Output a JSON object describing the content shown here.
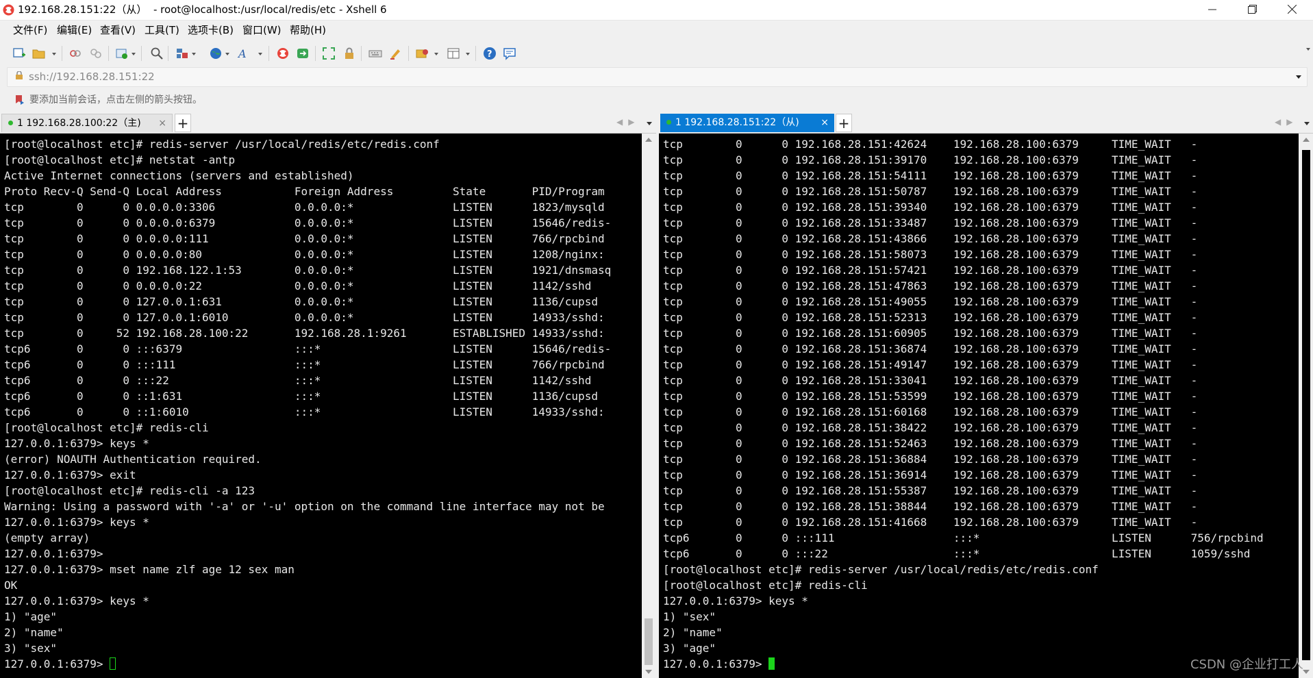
{
  "window": {
    "title": "192.168.28.151:22（从）  - root@localhost:/usr/local/redis/etc - Xshell 6",
    "minimize": "—",
    "close": "✕"
  },
  "menu": [
    "文件(F)",
    "编辑(E)",
    "查看(V)",
    "工具(T)",
    "选项卡(B)",
    "窗口(W)",
    "帮助(H)"
  ],
  "address": {
    "url": "ssh://192.168.28.151:22"
  },
  "hint": {
    "text": "要添加当前会话，点击左侧的箭头按钮。"
  },
  "tabs": {
    "left": {
      "label": "1 192.168.28.100:22（主)",
      "close": "×",
      "add": "+"
    },
    "right": {
      "label": "1 192.168.28.151:22（从)",
      "close": "×",
      "add": "+"
    }
  },
  "terminals": {
    "left": {
      "lines": [
        "[root@localhost etc]# redis-server /usr/local/redis/etc/redis.conf",
        "[root@localhost etc]# netstat -antp",
        "Active Internet connections (servers and established)",
        "Proto Recv-Q Send-Q Local Address           Foreign Address         State       PID/Program",
        "tcp        0      0 0.0.0.0:3306            0.0.0.0:*               LISTEN      1823/mysqld",
        "tcp        0      0 0.0.0.0:6379            0.0.0.0:*               LISTEN      15646/redis-",
        "tcp        0      0 0.0.0.0:111             0.0.0.0:*               LISTEN      766/rpcbind",
        "tcp        0      0 0.0.0.0:80              0.0.0.0:*               LISTEN      1208/nginx:",
        "tcp        0      0 192.168.122.1:53        0.0.0.0:*               LISTEN      1921/dnsmasq",
        "tcp        0      0 0.0.0.0:22              0.0.0.0:*               LISTEN      1142/sshd",
        "tcp        0      0 127.0.0.1:631           0.0.0.0:*               LISTEN      1136/cupsd",
        "tcp        0      0 127.0.0.1:6010          0.0.0.0:*               LISTEN      14933/sshd:",
        "tcp        0     52 192.168.28.100:22       192.168.28.1:9261       ESTABLISHED 14933/sshd:",
        "tcp6       0      0 :::6379                 :::*                    LISTEN      15646/redis-",
        "tcp6       0      0 :::111                  :::*                    LISTEN      766/rpcbind",
        "tcp6       0      0 :::22                   :::*                    LISTEN      1142/sshd",
        "tcp6       0      0 ::1:631                 :::*                    LISTEN      1136/cupsd",
        "tcp6       0      0 ::1:6010                :::*                    LISTEN      14933/sshd:",
        "[root@localhost etc]# redis-cli",
        "127.0.0.1:6379> keys *",
        "(error) NOAUTH Authentication required.",
        "127.0.0.1:6379> exit",
        "[root@localhost etc]# redis-cli -a 123",
        "Warning: Using a password with '-a' or '-u' option on the command line interface may not be",
        "127.0.0.1:6379> keys *",
        "(empty array)",
        "127.0.0.1:6379>",
        "127.0.0.1:6379> mset name zlf age 12 sex man",
        "OK",
        "127.0.0.1:6379> keys *",
        "1) \"age\"",
        "2) \"name\"",
        "3) \"sex\""
      ],
      "prompt": "127.0.0.1:6379> "
    },
    "right": {
      "lines": [
        "tcp        0      0 192.168.28.151:42624    192.168.28.100:6379     TIME_WAIT   -",
        "tcp        0      0 192.168.28.151:39170    192.168.28.100:6379     TIME_WAIT   -",
        "tcp        0      0 192.168.28.151:54111    192.168.28.100:6379     TIME_WAIT   -",
        "tcp        0      0 192.168.28.151:50787    192.168.28.100:6379     TIME_WAIT   -",
        "tcp        0      0 192.168.28.151:39340    192.168.28.100:6379     TIME_WAIT   -",
        "tcp        0      0 192.168.28.151:33487    192.168.28.100:6379     TIME_WAIT   -",
        "tcp        0      0 192.168.28.151:43866    192.168.28.100:6379     TIME_WAIT   -",
        "tcp        0      0 192.168.28.151:58073    192.168.28.100:6379     TIME_WAIT   -",
        "tcp        0      0 192.168.28.151:57421    192.168.28.100:6379     TIME_WAIT   -",
        "tcp        0      0 192.168.28.151:47863    192.168.28.100:6379     TIME_WAIT   -",
        "tcp        0      0 192.168.28.151:49055    192.168.28.100:6379     TIME_WAIT   -",
        "tcp        0      0 192.168.28.151:52313    192.168.28.100:6379     TIME_WAIT   -",
        "tcp        0      0 192.168.28.151:60905    192.168.28.100:6379     TIME_WAIT   -",
        "tcp        0      0 192.168.28.151:36874    192.168.28.100:6379     TIME_WAIT   -",
        "tcp        0      0 192.168.28.151:49147    192.168.28.100:6379     TIME_WAIT   -",
        "tcp        0      0 192.168.28.151:33041    192.168.28.100:6379     TIME_WAIT   -",
        "tcp        0      0 192.168.28.151:53599    192.168.28.100:6379     TIME_WAIT   -",
        "tcp        0      0 192.168.28.151:60168    192.168.28.100:6379     TIME_WAIT   -",
        "tcp        0      0 192.168.28.151:38422    192.168.28.100:6379     TIME_WAIT   -",
        "tcp        0      0 192.168.28.151:52463    192.168.28.100:6379     TIME_WAIT   -",
        "tcp        0      0 192.168.28.151:36884    192.168.28.100:6379     TIME_WAIT   -",
        "tcp        0      0 192.168.28.151:36914    192.168.28.100:6379     TIME_WAIT   -",
        "tcp        0      0 192.168.28.151:55387    192.168.28.100:6379     TIME_WAIT   -",
        "tcp        0      0 192.168.28.151:38844    192.168.28.100:6379     TIME_WAIT   -",
        "tcp        0      0 192.168.28.151:41668    192.168.28.100:6379     TIME_WAIT   -",
        "tcp6       0      0 :::111                  :::*                    LISTEN      756/rpcbind",
        "tcp6       0      0 :::22                   :::*                    LISTEN      1059/sshd",
        "[root@localhost etc]# redis-server /usr/local/redis/etc/redis.conf",
        "[root@localhost etc]# redis-cli",
        "127.0.0.1:6379> keys *",
        "1) \"sex\"",
        "2) \"name\"",
        "3) \"age\""
      ],
      "prompt": "127.0.0.1:6379> "
    }
  },
  "watermark": "CSDN @企业打工人",
  "colors": {
    "active_tab": "#0a7bd4",
    "cursor": "#1bd41b",
    "status_dot": "#2fb82f",
    "terminal_bg": "#000000",
    "terminal_fg": "#e8e8e8"
  }
}
